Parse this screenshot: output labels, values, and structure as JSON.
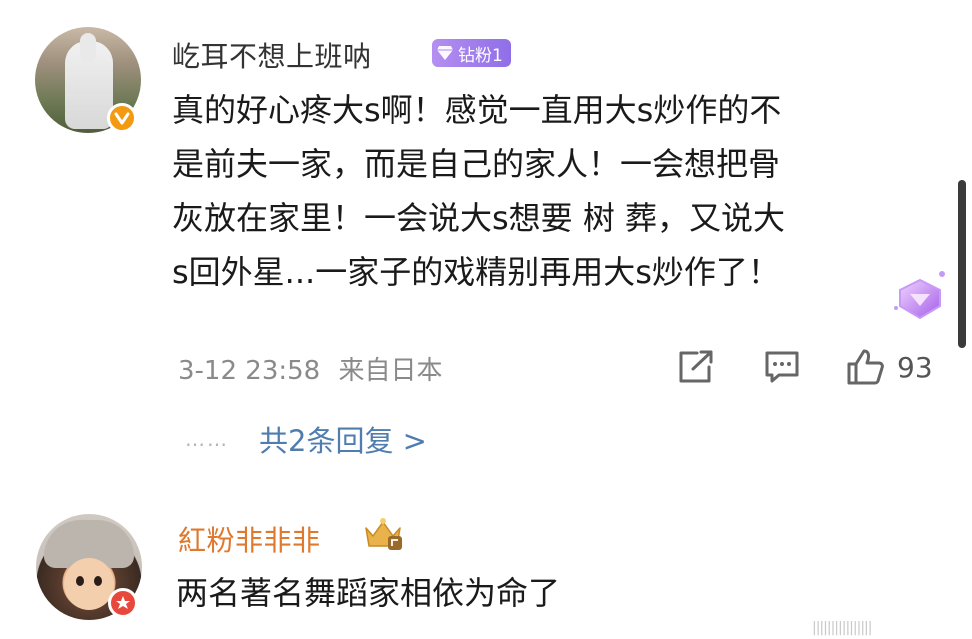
{
  "comment1": {
    "username": "屹耳不想上班呐",
    "fan_badge": "钻粉1",
    "verified_badge_icon": "orange-v-badge",
    "lines": [
      "真的好心疼大s啊！感觉一直用大s炒作的不",
      "是前夫一家，而是自己的家人！一会想把骨",
      "灰放在家里！一会说大s想要 树 葬，又说大",
      "s回外星...一家子的戏精别再用大s炒作了！"
    ],
    "timestamp": "3-12 23:58",
    "location": "来自日本",
    "like_count": "93",
    "replies_dots": "……",
    "replies_link": "共2条回复 >"
  },
  "comment2": {
    "username": "紅粉非非非",
    "text": "两名著名舞蹈家相依为命了"
  },
  "watermark": "||||||||||||||||",
  "colors": {
    "username_gray": "#333333",
    "username_orange": "#e0782e",
    "link_blue": "#507daf",
    "badge_purple": "#a07df0",
    "meta_gray": "#8a8a8a"
  }
}
